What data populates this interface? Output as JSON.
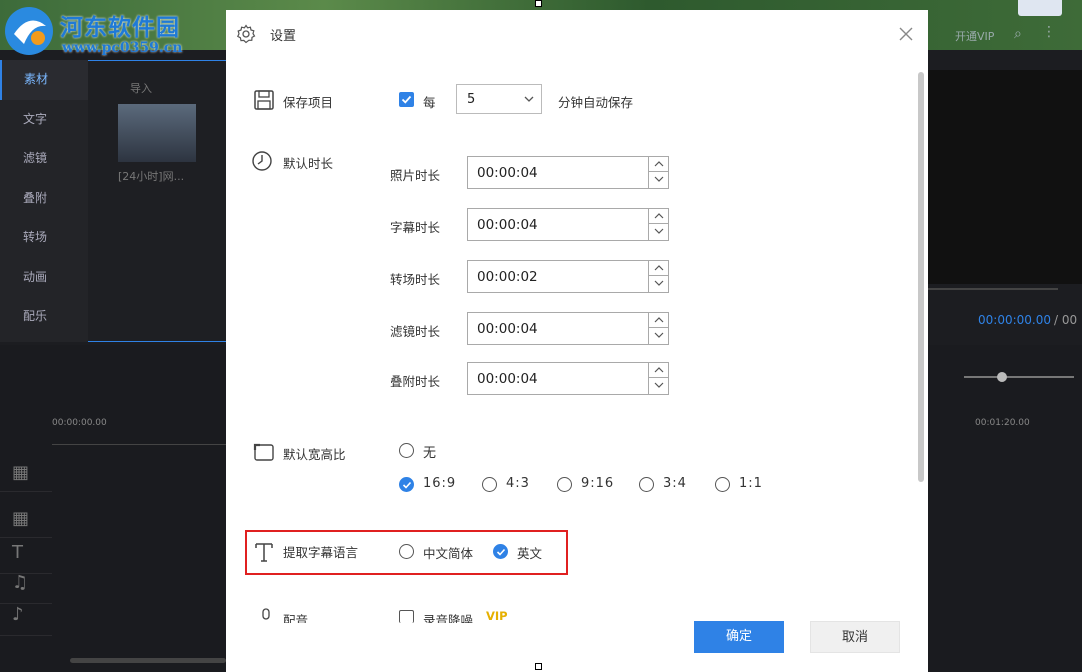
{
  "watermark": {
    "site_name": "河东软件园",
    "url": "www.pc0359.cn"
  },
  "app": {
    "topbar": {
      "vip_label": "开通VIP"
    },
    "nav_items": [
      "素材",
      "文字",
      "滤镜",
      "叠附",
      "转场",
      "动画",
      "配乐"
    ],
    "media_tabs": "导入",
    "thumb_caption": "[24小时]网...",
    "preview_time": "00:00:00.00",
    "preview_sep": "/ 00",
    "ruler_start": "00:00:00.00",
    "ruler_end": "00:01:20.00"
  },
  "dialog": {
    "title": "设置",
    "save": {
      "label": "保存项目",
      "checkbox_checked": true,
      "every": "每",
      "interval_value": "5",
      "suffix": "分钟自动保存"
    },
    "durations": {
      "label": "默认时长",
      "fields": [
        {
          "label": "照片时长",
          "value": "00:00:04"
        },
        {
          "label": "字幕时长",
          "value": "00:00:04"
        },
        {
          "label": "转场时长",
          "value": "00:00:02"
        },
        {
          "label": "滤镜时长",
          "value": "00:00:04"
        },
        {
          "label": "叠附时长",
          "value": "00:00:04"
        }
      ]
    },
    "aspect": {
      "label": "默认宽高比",
      "none_option": "无",
      "options": [
        "16:9",
        "4:3",
        "9:16",
        "3:4",
        "1:1"
      ],
      "selected": "16:9"
    },
    "subtitle_lang": {
      "label": "提取字幕语言",
      "options": [
        "中文简体",
        "英文"
      ],
      "selected": "英文"
    },
    "dubbing": {
      "label": "配音",
      "denoise_label": "录音降噪",
      "denoise_checked": false,
      "vip_tag": "VIP"
    },
    "buttons": {
      "ok": "确定",
      "cancel": "取消"
    }
  },
  "colors": {
    "accent": "#2f82e6",
    "highlight": "#e02020",
    "vip": "#e6b000"
  }
}
